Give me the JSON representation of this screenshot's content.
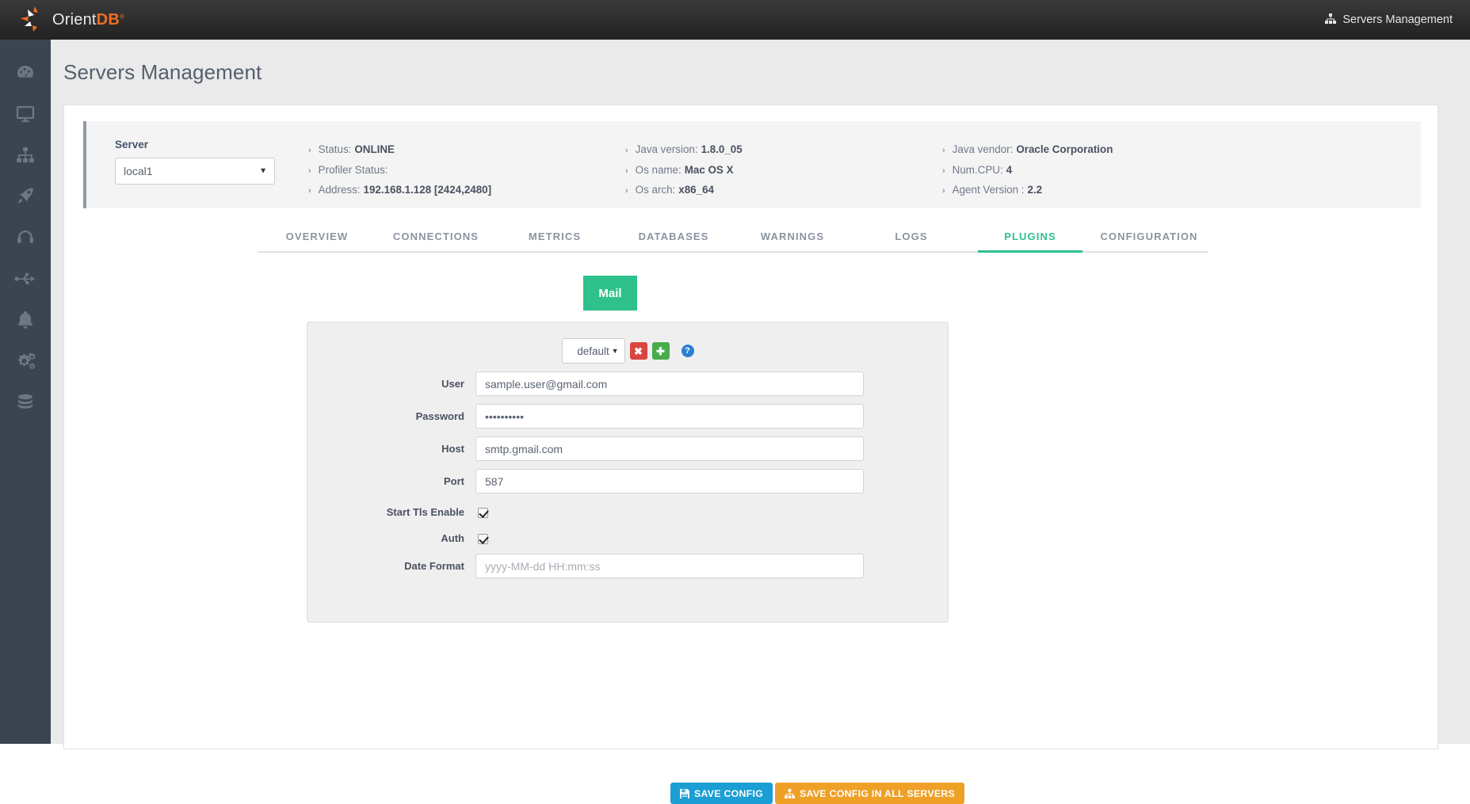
{
  "brand": {
    "name_light": "Orient",
    "name_bold": "DB",
    "trademark": "®"
  },
  "topbar": {
    "right_label": "Servers Management",
    "right_icon": "sitemap-icon"
  },
  "sidebar": {
    "items": [
      {
        "name": "dashboard",
        "icon": "dashboard-gauge-icon"
      },
      {
        "name": "monitor",
        "icon": "desktop-monitor-icon"
      },
      {
        "name": "servers",
        "icon": "sitemap-icon"
      },
      {
        "name": "deploy",
        "icon": "rocket-icon"
      },
      {
        "name": "support",
        "icon": "headphones-icon"
      },
      {
        "name": "connections",
        "icon": "usb-icon"
      },
      {
        "name": "alerts",
        "icon": "bell-icon"
      },
      {
        "name": "settings",
        "icon": "cogs-icon"
      },
      {
        "name": "database",
        "icon": "database-icon"
      }
    ]
  },
  "page": {
    "title": "Servers Management"
  },
  "server_panel": {
    "server_label": "Server",
    "server_selected": "local1",
    "columns": [
      [
        {
          "label": "Status:",
          "value": "ONLINE"
        },
        {
          "label": "Profiler Status:",
          "value": ""
        },
        {
          "label": "Address:",
          "value": "192.168.1.128 [2424,2480]"
        }
      ],
      [
        {
          "label": "Java version:",
          "value": "1.8.0_05"
        },
        {
          "label": "Os name:",
          "value": "Mac OS X"
        },
        {
          "label": "Os arch:",
          "value": "x86_64"
        }
      ],
      [
        {
          "label": "Java vendor:",
          "value": "Oracle Corporation"
        },
        {
          "label": "Num.CPU:",
          "value": "4"
        },
        {
          "label": "Agent Version :",
          "value": "2.2"
        }
      ]
    ]
  },
  "tabs": {
    "items": [
      {
        "label": "OVERVIEW",
        "active": false
      },
      {
        "label": "CONNECTIONS",
        "active": false
      },
      {
        "label": "METRICS",
        "active": false
      },
      {
        "label": "DATABASES",
        "active": false
      },
      {
        "label": "WARNINGS",
        "active": false
      },
      {
        "label": "LOGS",
        "active": false
      },
      {
        "label": "PLUGINS",
        "active": true
      },
      {
        "label": "CONFIGURATION",
        "active": false
      }
    ],
    "active_color": "#2ec18c"
  },
  "plugins": {
    "buttons": [
      {
        "label": "Mail",
        "active": true
      }
    ]
  },
  "config": {
    "profile_selected": "default",
    "delete_label": "✖",
    "add_label": "✚",
    "help_label": "?"
  },
  "form": {
    "fields": [
      {
        "label": "User",
        "type": "text",
        "value": "sample.user@gmail.com",
        "placeholder": ""
      },
      {
        "label": "Password",
        "type": "password",
        "value": "••••••••••",
        "placeholder": ""
      },
      {
        "label": "Host",
        "type": "text",
        "value": "smtp.gmail.com",
        "placeholder": ""
      },
      {
        "label": "Port",
        "type": "text",
        "value": "587",
        "placeholder": ""
      },
      {
        "label": "Start Tls Enable",
        "type": "checkbox",
        "checked": true
      },
      {
        "label": "Auth",
        "type": "checkbox",
        "checked": true
      },
      {
        "label": "Date Format",
        "type": "text",
        "value": "",
        "placeholder": "yyyy-MM-dd HH:mm:ss"
      }
    ]
  },
  "actions": {
    "save_config": "SAVE CONFIG",
    "save_config_all": "SAVE CONFIG IN ALL SERVERS",
    "save_icon": "floppy-disk-icon",
    "save_all_icon": "sitemap-icon"
  }
}
